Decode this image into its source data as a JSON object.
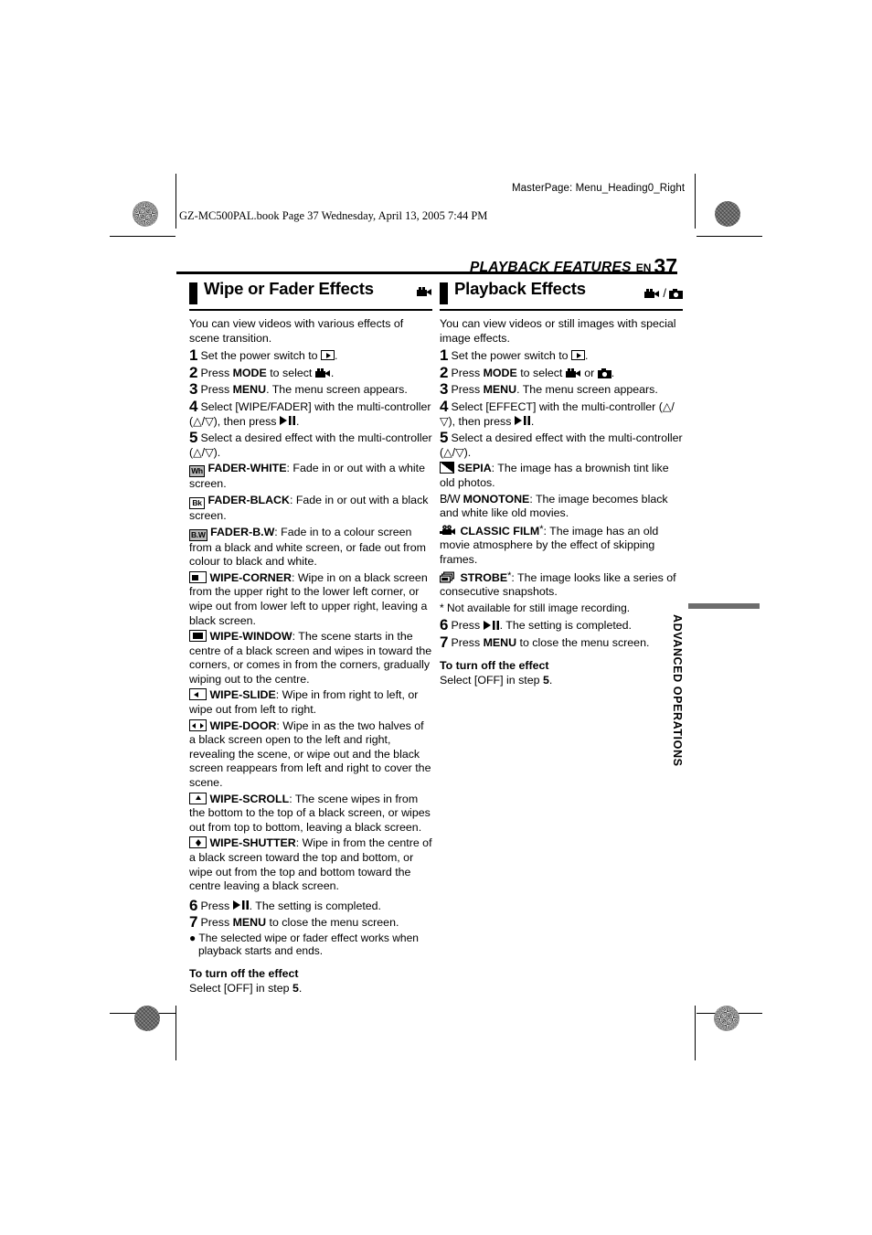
{
  "page": {
    "masterpage": "MasterPage: Menu_Heading0_Right",
    "bookline": "GZ-MC500PAL.book  Page 37  Wednesday, April 13, 2005  7:44 PM",
    "running_head": "PLAYBACK FEATURES",
    "lang_code": "EN",
    "page_number": "37",
    "thumb_tab": "ADVANCED OPERATIONS",
    "ink_color": "#000000",
    "thumb_color": "#6d6d6d"
  },
  "left_column": {
    "heading": "Wipe or Fader Effects",
    "mode_icons": [
      "video-camera-icon"
    ],
    "intro": "You can view videos with various effects of scene transition.",
    "steps": [
      {
        "num": "1",
        "parts": [
          {
            "t": "text",
            "v": "Set the power switch to "
          },
          {
            "t": "icon",
            "v": "play-icon"
          },
          {
            "t": "text",
            "v": "."
          }
        ]
      },
      {
        "num": "2",
        "parts": [
          {
            "t": "text",
            "v": "Press "
          },
          {
            "t": "bold",
            "v": "MODE"
          },
          {
            "t": "text",
            "v": " to select "
          },
          {
            "t": "icon",
            "v": "video-camera-icon"
          },
          {
            "t": "text",
            "v": "."
          }
        ]
      },
      {
        "num": "3",
        "parts": [
          {
            "t": "text",
            "v": "Press "
          },
          {
            "t": "bold",
            "v": "MENU"
          },
          {
            "t": "text",
            "v": ". The menu screen appears."
          }
        ]
      },
      {
        "num": "4",
        "parts": [
          {
            "t": "text",
            "v": "Select [WIPE/FADER] with the multi-controller (△/▽), then press "
          },
          {
            "t": "icon",
            "v": "play-pause-icon"
          },
          {
            "t": "text",
            "v": "."
          }
        ]
      },
      {
        "num": "5",
        "parts": [
          {
            "t": "text",
            "v": "Select a desired effect with the multi-controller (△/▽)."
          }
        ]
      }
    ],
    "effects": [
      {
        "icon": "fader-white-icon",
        "icon_label": "Wh",
        "name": "FADER-WHITE",
        "desc": ": Fade in or out with a white screen."
      },
      {
        "icon": "fader-black-icon",
        "icon_label": "Bk",
        "name": "FADER-BLACK",
        "desc": ": Fade in or out with a black screen."
      },
      {
        "icon": "fader-bw-icon",
        "icon_label": "B.W",
        "name": "FADER-B.W",
        "desc": ": Fade in to a colour screen from a black and white screen, or fade out from colour to black and white."
      },
      {
        "icon": "wipe-corner-icon",
        "name": "WIPE-CORNER",
        "desc": ": Wipe in on a black screen from the upper right to the lower left corner, or wipe out from lower left to upper right, leaving a black screen."
      },
      {
        "icon": "wipe-window-icon",
        "name": "WIPE-WINDOW",
        "desc": ": The scene starts in the centre of a black screen and wipes in toward the corners, or comes in from the corners, gradually wiping out to the centre."
      },
      {
        "icon": "wipe-slide-icon",
        "name": "WIPE-SLIDE",
        "desc": ": Wipe in from right to left, or wipe out from left to right."
      },
      {
        "icon": "wipe-door-icon",
        "name": "WIPE-DOOR",
        "desc": ": Wipe in as the two halves of a black screen open to the left and right, revealing the scene, or wipe out and the black screen reappears from left and right to cover the scene."
      },
      {
        "icon": "wipe-scroll-icon",
        "name": "WIPE-SCROLL",
        "desc": ": The scene wipes in from the bottom to the top of a black screen, or wipes out from top to bottom, leaving a black screen."
      },
      {
        "icon": "wipe-shutter-icon",
        "name": "WIPE-SHUTTER",
        "desc": ": Wipe in from the centre of a black screen toward the top and bottom, or wipe out from the top and bottom toward the centre leaving a black screen."
      }
    ],
    "steps_tail": [
      {
        "num": "6",
        "parts": [
          {
            "t": "text",
            "v": "Press "
          },
          {
            "t": "icon",
            "v": "play-pause-icon"
          },
          {
            "t": "text",
            "v": ". The setting is completed."
          }
        ]
      },
      {
        "num": "7",
        "parts": [
          {
            "t": "text",
            "v": "Press "
          },
          {
            "t": "bold",
            "v": "MENU"
          },
          {
            "t": "text",
            "v": " to close the menu screen."
          }
        ]
      }
    ],
    "bullet": "● The selected wipe or fader effect works when playback starts and ends.",
    "turn_off_heading": "To turn off the effect",
    "turn_off_body_pre": "Select [OFF] in step ",
    "turn_off_step": "5",
    "turn_off_body_post": "."
  },
  "right_column": {
    "heading": "Playback Effects",
    "mode_icons": [
      "video-camera-icon",
      "still-camera-icon"
    ],
    "mode_separator": "/",
    "intro": "You can view videos or still images with special image effects.",
    "steps": [
      {
        "num": "1",
        "parts": [
          {
            "t": "text",
            "v": "Set the power switch to "
          },
          {
            "t": "icon",
            "v": "play-icon"
          },
          {
            "t": "text",
            "v": "."
          }
        ]
      },
      {
        "num": "2",
        "parts": [
          {
            "t": "text",
            "v": "Press "
          },
          {
            "t": "bold",
            "v": "MODE"
          },
          {
            "t": "text",
            "v": " to select "
          },
          {
            "t": "icon",
            "v": "video-camera-icon"
          },
          {
            "t": "text",
            "v": " or "
          },
          {
            "t": "icon",
            "v": "still-camera-icon"
          },
          {
            "t": "text",
            "v": "."
          }
        ]
      },
      {
        "num": "3",
        "parts": [
          {
            "t": "text",
            "v": "Press "
          },
          {
            "t": "bold",
            "v": "MENU"
          },
          {
            "t": "text",
            "v": ". The menu screen appears."
          }
        ]
      },
      {
        "num": "4",
        "parts": [
          {
            "t": "text",
            "v": "Select [EFFECT] with the multi-controller (△/▽), then press "
          },
          {
            "t": "icon",
            "v": "play-pause-icon"
          },
          {
            "t": "text",
            "v": "."
          }
        ]
      },
      {
        "num": "5",
        "parts": [
          {
            "t": "text",
            "v": "Select a desired effect with the multi-controller (△/▽)."
          }
        ]
      }
    ],
    "effects": [
      {
        "icon": "sepia-icon",
        "name": "SEPIA",
        "star": "",
        "desc": ": The image has a brownish tint like old photos."
      },
      {
        "icon": "monotone-icon",
        "icon_label": "B/W",
        "name": "MONOTONE",
        "star": "",
        "desc": ": The image becomes black and white like old movies."
      },
      {
        "icon": "classic-film-icon",
        "name": "CLASSIC FILM",
        "star": "*",
        "desc": ": The image has an old movie atmosphere by the effect of skipping frames."
      },
      {
        "icon": "strobe-icon",
        "name": "STROBE",
        "star": "*",
        "desc": ": The image looks like a series of consecutive snapshots."
      }
    ],
    "footnote": "*  Not available for still image recording.",
    "steps_tail": [
      {
        "num": "6",
        "parts": [
          {
            "t": "text",
            "v": "Press "
          },
          {
            "t": "icon",
            "v": "play-pause-icon"
          },
          {
            "t": "text",
            "v": ". The setting is completed."
          }
        ]
      },
      {
        "num": "7",
        "parts": [
          {
            "t": "text",
            "v": "Press "
          },
          {
            "t": "bold",
            "v": "MENU"
          },
          {
            "t": "text",
            "v": " to close the menu screen."
          }
        ]
      }
    ],
    "turn_off_heading": "To turn off the effect",
    "turn_off_body_pre": "Select [OFF] in step ",
    "turn_off_step": "5",
    "turn_off_body_post": "."
  }
}
